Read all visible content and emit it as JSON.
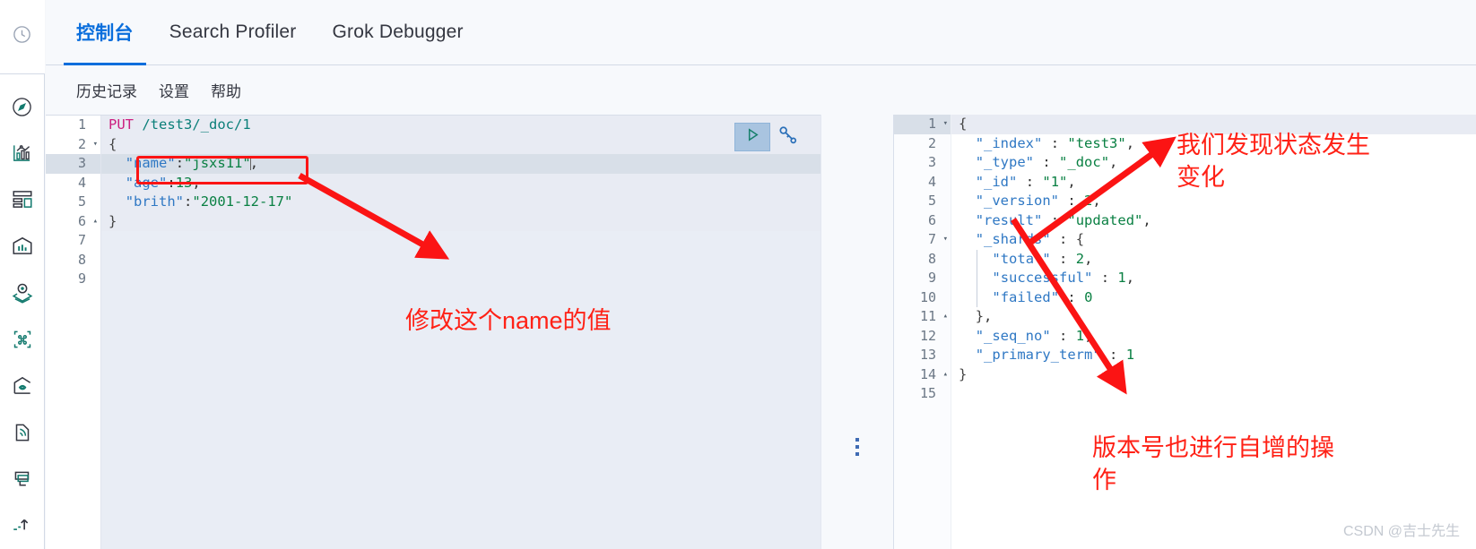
{
  "sidebar": {
    "top_icon": "clock-icon",
    "items": [
      {
        "name": "compass-icon",
        "label": "Discover"
      },
      {
        "name": "chart-icon",
        "label": "Visualize"
      },
      {
        "name": "dashboard-icon",
        "label": "Dashboard"
      },
      {
        "name": "canvas-icon",
        "label": "Canvas"
      },
      {
        "name": "maps-icon",
        "label": "Maps"
      },
      {
        "name": "ml-icon",
        "label": "Machine Learning"
      },
      {
        "name": "infra-icon",
        "label": "Infrastructure"
      },
      {
        "name": "logs-icon",
        "label": "Logs"
      },
      {
        "name": "apm-icon",
        "label": "APM"
      },
      {
        "name": "uptime-icon",
        "label": "Uptime"
      }
    ]
  },
  "tabs": [
    {
      "label": "控制台",
      "active": true
    },
    {
      "label": "Search Profiler",
      "active": false
    },
    {
      "label": "Grok Debugger",
      "active": false
    }
  ],
  "submenu": [
    {
      "label": "历史记录"
    },
    {
      "label": "设置"
    },
    {
      "label": "帮助"
    }
  ],
  "editor": {
    "run_icon": "play-icon",
    "wrench_icon": "wrench-icon",
    "resize_handle": "resize-dots-handle",
    "total_lines": 9,
    "active_line": 3,
    "lines": [
      {
        "n": 1,
        "fold": "",
        "text": "PUT /test3/_doc/1"
      },
      {
        "n": 2,
        "fold": "▾",
        "text": "{"
      },
      {
        "n": 3,
        "fold": "",
        "text": "  \"name\":\"jsxs11\","
      },
      {
        "n": 4,
        "fold": "",
        "text": "  \"age\":13,"
      },
      {
        "n": 5,
        "fold": "",
        "text": "  \"brith\":\"2001-12-17\""
      },
      {
        "n": 6,
        "fold": "▴",
        "text": "}"
      },
      {
        "n": 7,
        "fold": "",
        "text": ""
      },
      {
        "n": 8,
        "fold": "",
        "text": ""
      },
      {
        "n": 9,
        "fold": "",
        "text": ""
      }
    ],
    "request": {
      "method": "PUT",
      "path": "/test3/_doc/1",
      "body": {
        "name": "jsxs11",
        "age": 13,
        "brith": "2001-12-17"
      }
    }
  },
  "response": {
    "total_lines": 15,
    "active_line": 1,
    "lines": [
      {
        "n": 1,
        "fold": "▾",
        "text": "{"
      },
      {
        "n": 2,
        "fold": "",
        "text": "  \"_index\" : \"test3\","
      },
      {
        "n": 3,
        "fold": "",
        "text": "  \"_type\" : \"_doc\","
      },
      {
        "n": 4,
        "fold": "",
        "text": "  \"_id\" : \"1\","
      },
      {
        "n": 5,
        "fold": "",
        "text": "  \"_version\" : 2,"
      },
      {
        "n": 6,
        "fold": "",
        "text": "  \"result\" : \"updated\","
      },
      {
        "n": 7,
        "fold": "▾",
        "text": "  \"_shards\" : {"
      },
      {
        "n": 8,
        "fold": "",
        "text": "    \"total\" : 2,"
      },
      {
        "n": 9,
        "fold": "",
        "text": "    \"successful\" : 1,"
      },
      {
        "n": 10,
        "fold": "",
        "text": "    \"failed\" : 0"
      },
      {
        "n": 11,
        "fold": "▴",
        "text": "  },"
      },
      {
        "n": 12,
        "fold": "",
        "text": "  \"_seq_no\" : 1,"
      },
      {
        "n": 13,
        "fold": "",
        "text": "  \"_primary_term\" : 1"
      },
      {
        "n": 14,
        "fold": "▴",
        "text": "}"
      },
      {
        "n": 15,
        "fold": "",
        "text": ""
      }
    ],
    "body": {
      "_index": "test3",
      "_type": "_doc",
      "_id": "1",
      "_version": 2,
      "result": "updated",
      "_shards": {
        "total": 2,
        "successful": 1,
        "failed": 0
      },
      "_seq_no": 1,
      "_primary_term": 1
    }
  },
  "annotations": {
    "color": "#ff2116",
    "edit_name": "修改这个name的值",
    "status_changed": "我们发现状态发生\n变化",
    "version_increment": "版本号也进行自增的操\n作"
  },
  "watermark": "CSDN @吉士先生",
  "colors": {
    "accent": "#0a6edc",
    "annotation": "#ff2116",
    "editor_bg": "#e9edf5",
    "response_bg": "#ffffff",
    "active_line": "#d8dfe8"
  }
}
